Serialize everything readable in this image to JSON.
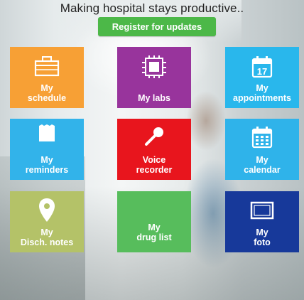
{
  "header": {
    "headline": "Making hospital stays productive..",
    "register_label": "Register for updates"
  },
  "tiles": [
    {
      "label": "My\nschedule",
      "color": "#f7a035",
      "icon": "briefcase-icon"
    },
    {
      "label": "My labs",
      "color": "#98349c",
      "icon": "chip-icon"
    },
    {
      "label": "My\nappointments",
      "color": "#29b7ec",
      "icon": "calendar-day-icon",
      "icon_text": "17"
    },
    {
      "label": "My\nreminders",
      "color": "#32b3ea",
      "icon": "note-icon"
    },
    {
      "label": "Voice\nrecorder",
      "color": "#e8151d",
      "icon": "microphone-icon"
    },
    {
      "label": "My\ncalendar",
      "color": "#2fb3ea",
      "icon": "calendar-grid-icon"
    },
    {
      "label": "My\nDisch. notes",
      "color": "#b4c268",
      "icon": "map-pin-icon"
    },
    {
      "label": "My\ndrug list",
      "color": "#57bd5c",
      "icon": "none"
    },
    {
      "label": "My\nfoto",
      "color": "#17399a",
      "icon": "monitor-icon"
    }
  ]
}
